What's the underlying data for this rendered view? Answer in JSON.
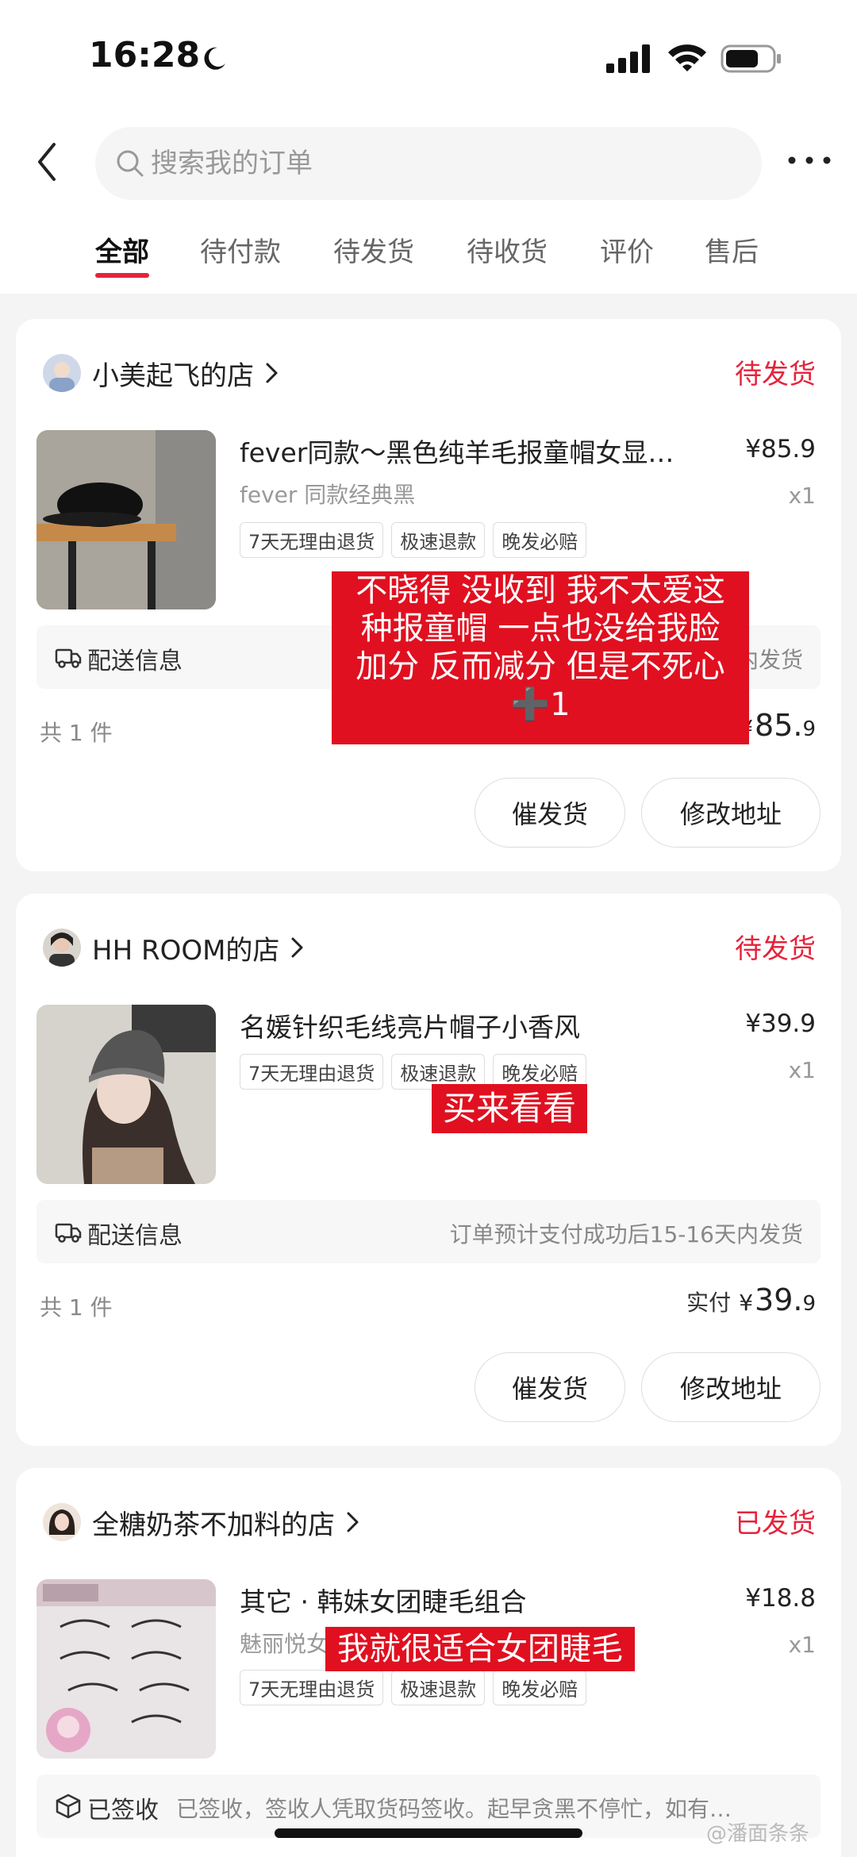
{
  "status_bar": {
    "time": "16:28"
  },
  "header": {
    "search_placeholder": "搜索我的订单",
    "tabs": [
      {
        "label": "全部"
      },
      {
        "label": "待付款"
      },
      {
        "label": "待发货"
      },
      {
        "label": "待收货"
      },
      {
        "label": "评价"
      },
      {
        "label": "售后"
      }
    ],
    "active_tab": "全部"
  },
  "orders": [
    {
      "shop": "小美起飞的店",
      "status": "待发货",
      "title": "fever同款～黑色纯羊毛报童帽女显…",
      "spec": "fever 同款经典黑",
      "price": "¥85.9",
      "qty": "x1",
      "tags": [
        "7天无理由退货",
        "极速退款",
        "晚发必赔"
      ],
      "delivery_label": "配送信息",
      "delivery_text": "内发货",
      "count": "共 1 件",
      "paid_label": "",
      "yen": "¥",
      "amount_int": "85.",
      "amount_dec": "9",
      "buttons": [
        "催发货",
        "修改地址"
      ],
      "caption": [
        "不晓得 没收到 我不太爱这",
        "种报童帽 一点也没给我脸",
        "加分 反而减分 但是不死心",
        "➕1"
      ]
    },
    {
      "shop": "HH ROOM的店",
      "status": "待发货",
      "title": "名媛针织毛线亮片帽子小香风",
      "price": "¥39.9",
      "qty": "x1",
      "tags": [
        "7天无理由退货",
        "极速退款",
        "晚发必赔"
      ],
      "delivery_label": "配送信息",
      "delivery_text": "订单预计支付成功后15-16天内发货",
      "count": "共 1 件",
      "paid_label": "实付",
      "yen": "¥",
      "amount_int": "39.",
      "amount_dec": "9",
      "buttons": [
        "催发货",
        "修改地址"
      ],
      "caption": [
        "买来看看"
      ]
    },
    {
      "shop": "全糖奶茶不加料的店",
      "status": "已发货",
      "title": "其它 · 韩妹女团睫毛组合",
      "spec": "魅丽悦女",
      "price": "¥18.8",
      "qty": "x1",
      "tags": [
        "7天无理由退货",
        "极速退款",
        "晚发必赔"
      ],
      "delivery_label": "已签收",
      "delivery_text": "已签收，签收人凭取货码签收。起早贪黑不停忙，如有…",
      "caption": [
        "我就很适合女团睫毛"
      ]
    }
  ],
  "watermark": "@潘面条条",
  "colors": {
    "accent": "#e5243c",
    "caption_bg": "#e01020"
  }
}
